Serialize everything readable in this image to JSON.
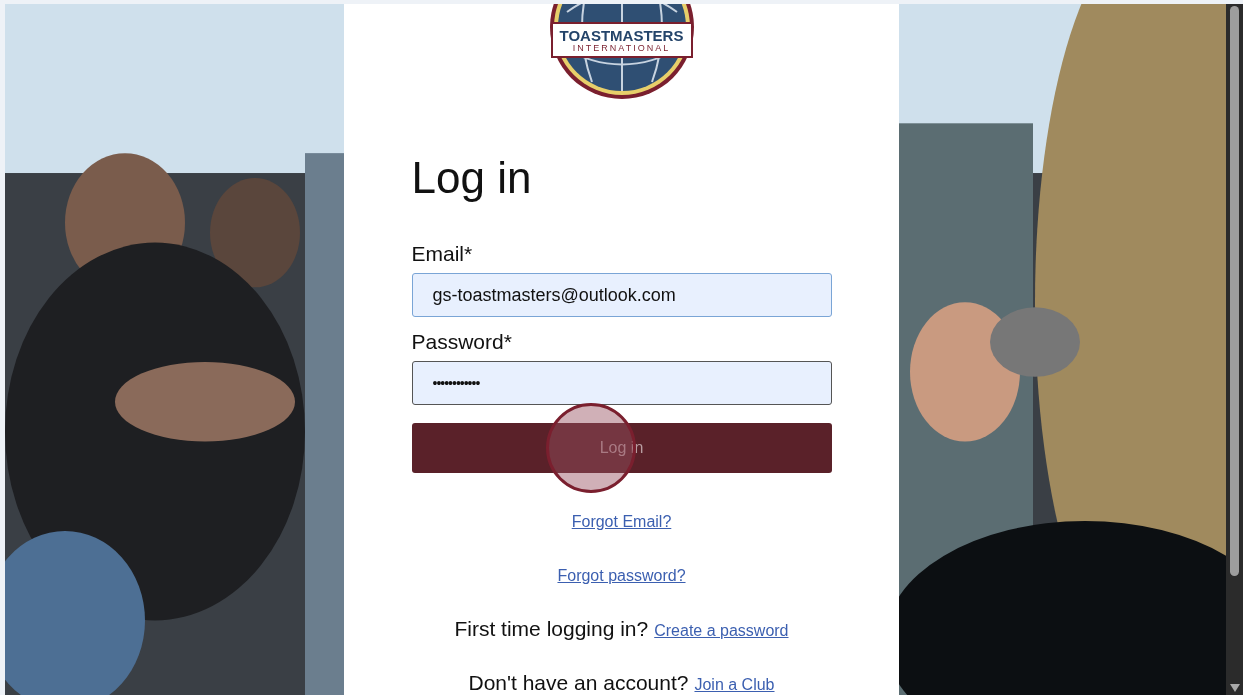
{
  "logo": {
    "name": "TOASTMASTERS",
    "subtitle": "INTERNATIONAL"
  },
  "heading": "Log in",
  "fields": [
    {
      "label": "Email*",
      "value": "gs-toastmasters@outlook.com",
      "kind": "text"
    },
    {
      "label": "Password*",
      "value": "••••••••••••",
      "kind": "password"
    }
  ],
  "submit_button": {
    "label": "Log in",
    "clicked": true
  },
  "links": [
    {
      "text": "Forgot Email?"
    },
    {
      "text": "Forgot password?"
    }
  ],
  "prompts": [
    {
      "text": "First time logging in?",
      "link": "Create a password"
    },
    {
      "text": "Don't have an account?",
      "link": "Join a Club"
    }
  ]
}
